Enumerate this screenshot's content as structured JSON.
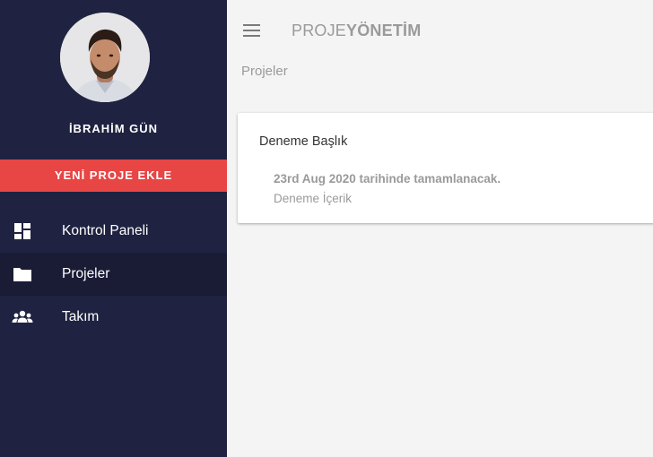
{
  "sidebar": {
    "user_name": "İBRAHİM GÜN",
    "new_project_label": "YENİ PROJE EKLE",
    "items": [
      {
        "label": "Kontrol Paneli",
        "icon": "dashboard-icon"
      },
      {
        "label": "Projeler",
        "icon": "folder-icon",
        "active": true
      },
      {
        "label": "Takım",
        "icon": "team-icon"
      }
    ]
  },
  "header": {
    "brand_light": "PROJE",
    "brand_bold": "YÖNETİM",
    "breadcrumb": "Projeler"
  },
  "projects": [
    {
      "title": "Deneme Başlık",
      "due_text": "23rd Aug 2020 tarihinde tamamlanacak.",
      "content": "Deneme İçerik"
    }
  ],
  "colors": {
    "sidebar_bg": "#1f2240",
    "sidebar_active_bg": "#1a1c36",
    "accent_red": "#e84545",
    "page_bg": "#f4f4f4",
    "muted_text": "#9a9a9a"
  }
}
